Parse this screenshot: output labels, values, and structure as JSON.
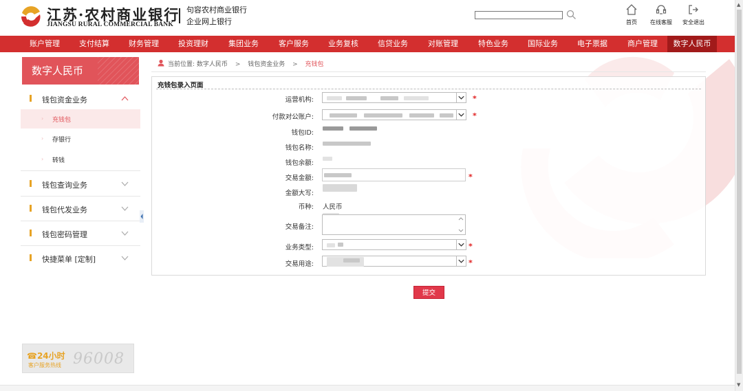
{
  "header": {
    "logo_cn": "江苏·农村商业银行",
    "logo_en": "JIANGSU RURAL COMMERCIAL BANK",
    "bank_line1": "句容农村商业银行",
    "bank_line2": "企业网上银行",
    "search_value": "",
    "links": [
      {
        "label": "首页",
        "icon": "home-icon"
      },
      {
        "label": "在线客服",
        "icon": "headset-icon"
      },
      {
        "label": "安全退出",
        "icon": "logout-icon"
      }
    ]
  },
  "nav": {
    "items": [
      "账户管理",
      "支付结算",
      "财务管理",
      "投资理财",
      "集团业务",
      "客户服务",
      "业务复核",
      "信贷业务",
      "对账管理",
      "特色业务",
      "国际业务",
      "电子票据",
      "商户管理",
      "数字人民币"
    ],
    "active": "数字人民币"
  },
  "sidebar": {
    "title": "数字人民币",
    "sections": [
      {
        "label": "钱包资金业务",
        "expanded": true,
        "children": [
          "充钱包",
          "存银行",
          "转钱"
        ],
        "active_child": "充钱包"
      },
      {
        "label": "钱包查询业务",
        "expanded": false
      },
      {
        "label": "钱包代发业务",
        "expanded": false
      },
      {
        "label": "钱包密码管理",
        "expanded": false
      },
      {
        "label": "快捷菜单 [定制]",
        "expanded": false
      }
    ],
    "hotline": {
      "hours": "24小时",
      "caption": "客户服务热线",
      "number": "96008"
    }
  },
  "breadcrumb": {
    "prefix": "当前位置:",
    "items": [
      "数字人民币",
      "钱包资金业务"
    ],
    "current": "充钱包",
    "separator": ">"
  },
  "form": {
    "title": "充钱包录入页面",
    "fields": {
      "org": {
        "label": "运营机构:",
        "required": true
      },
      "account": {
        "label": "付款对公账户:",
        "required": true
      },
      "wallet_id": {
        "label": "钱包ID:"
      },
      "wallet_name": {
        "label": "钱包名称:"
      },
      "balance": {
        "label": "钱包余额:"
      },
      "amount": {
        "label": "交易金额:",
        "required": true
      },
      "amount_upper": {
        "label": "金额大写:"
      },
      "currency": {
        "label": "币种:",
        "value": "人民币"
      },
      "remark": {
        "label": "交易备注:"
      },
      "biz_type": {
        "label": "业务类型:",
        "required": true
      },
      "purpose": {
        "label": "交易用途:",
        "required": true
      }
    },
    "required_mark": "*",
    "submit_label": "提交"
  },
  "colors": {
    "brand_red": "#d32f2f",
    "nav_active": "#a11a1a",
    "sidebar_title": "#e1545a",
    "required": "#e02020",
    "submit": "#e1384a"
  }
}
